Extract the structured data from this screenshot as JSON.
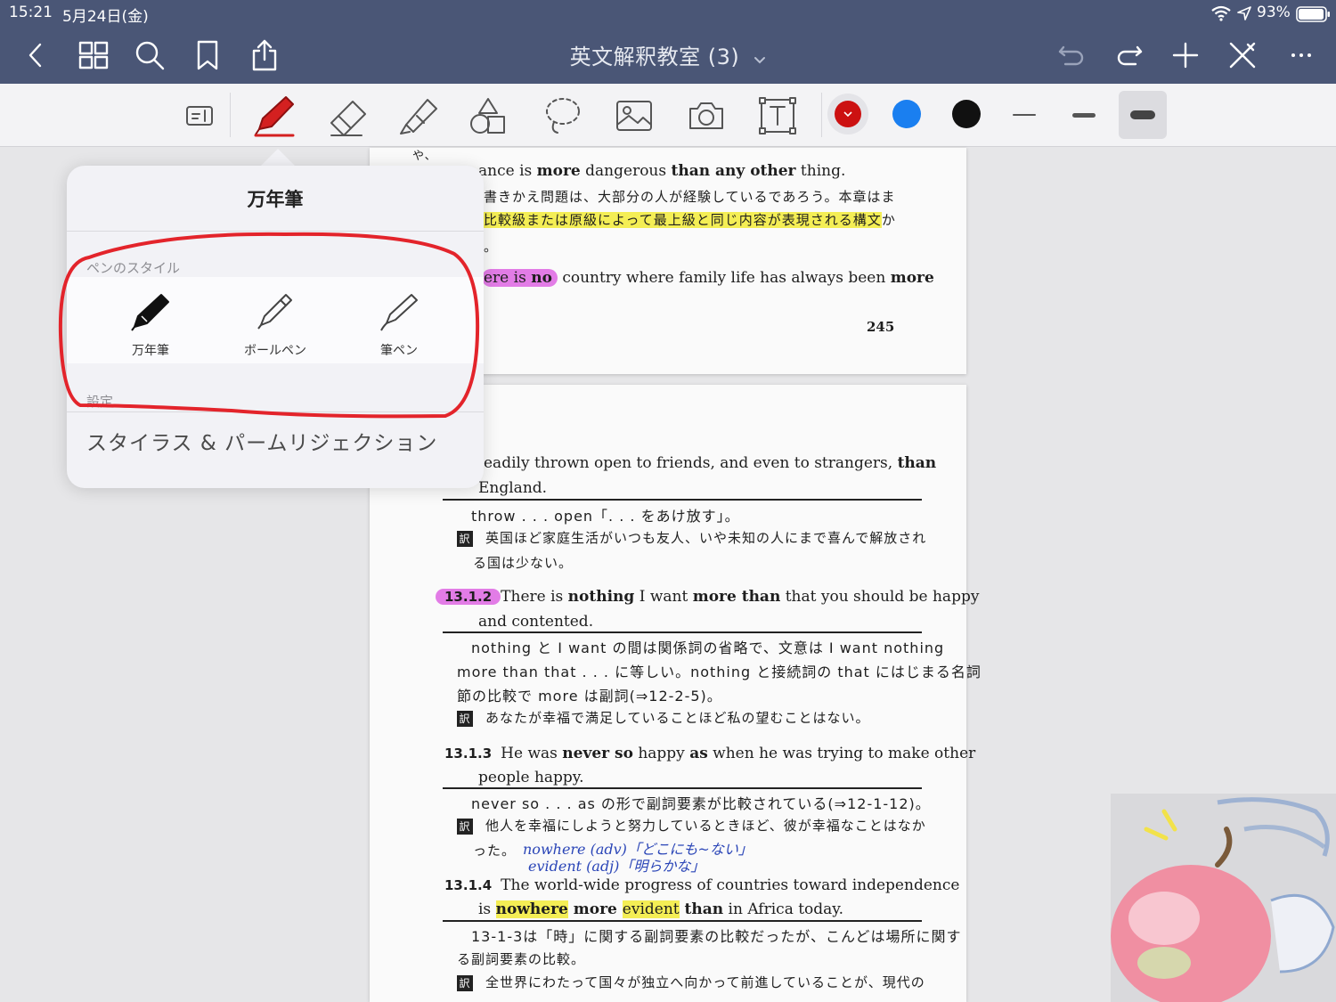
{
  "status_bar": {
    "time": "15:21",
    "date": "5月24日(金)",
    "battery_percent": "93%",
    "icons": [
      "wifi-icon",
      "location-icon",
      "battery-icon"
    ]
  },
  "nav": {
    "title": "英文解釈教室 (3)",
    "left_icons": [
      "back-icon",
      "grid-icon",
      "search-icon",
      "bookmark-icon",
      "share-icon"
    ],
    "right_icons": [
      "undo-icon",
      "redo-icon",
      "plus-icon",
      "close-icon",
      "more-icon"
    ]
  },
  "toolbar": {
    "tools": [
      "read-mode",
      "pen",
      "eraser",
      "highlighter",
      "shapes",
      "lasso",
      "image",
      "camera",
      "text"
    ],
    "selected_tool": "pen",
    "colors": [
      "#cc1111",
      "#1a7ff0",
      "#111111"
    ],
    "selected_color": "#cc1111",
    "thickness_selected": "thick"
  },
  "popover": {
    "title": "万年筆",
    "section_pen_style": "ペンのスタイル",
    "pens": [
      {
        "label": "万年筆"
      },
      {
        "label": "ボールペン"
      },
      {
        "label": "筆ペン"
      }
    ],
    "section_settings": "設定",
    "settings_item": "スタイラス & パームリジェクション"
  },
  "page1": {
    "top_fragment": "や、",
    "line1_pre": "ance is ",
    "line1_b1": "more",
    "line1_mid": " dangerous ",
    "line1_b2": "than any other",
    "line1_post": " thing.",
    "jp1": "書きかえ問題は、大部分の人が経験しているであろう。本章はま",
    "jp2_hl": "比較級または原級によって最上級と同じ内容が表現される構文",
    "jp2_tail": "か",
    "jp3": "。",
    "line4_hl_pre": "ere is ",
    "line4_hl_b": "no",
    "line4_post": " country where family life has always been ",
    "line4_b": "more",
    "page_number": "245"
  },
  "page2": {
    "l1_pre": "eadily thrown open to friends, and even to strangers, ",
    "l1_b": "than",
    "l2": "England.",
    "note1": "throw . . . open「. . . をあけ放す」。",
    "trans_mark": "訳",
    "trans1a": "英国ほど家庭生活がいつも友人、いや未知の人にまで喜んで解放され",
    "trans1b": "る国は少ない。",
    "ex2_num": "13.1.2",
    "ex2_pre": "There is ",
    "ex2_b1": "nothing",
    "ex2_mid": " I want ",
    "ex2_b2": "more than",
    "ex2_post": " that you should be happy",
    "ex2_l2": "and contented.",
    "note2a": "nothing と I  want の間は関係詞の省略で、文意は I  want  nothing",
    "note2b": "more than that . . . に等しい。nothing と接続詞の that にはじまる名詞",
    "note2c": "節の比較で more は副詞(⇒12-2-5)。",
    "trans2": "あなたが幸福で満足していることほど私の望むことはない。",
    "ex3_num": "13.1.3",
    "ex3_pre": "He was ",
    "ex3_b1": "never so",
    "ex3_mid": " happy ",
    "ex3_b2": "as",
    "ex3_post": " when he was trying to make other",
    "ex3_l2": "people happy.",
    "note3": "never so . . . as の形で副詞要素が比較されている(⇒12-1-12)。",
    "trans3a": "他人を幸福にしようと努力しているときほど、彼が幸福なことはなか",
    "trans3b": "った。",
    "hand1": "nowhere (adv)「どこにも~ない」",
    "hand2": "evident (adj)「明らかな」",
    "ex4_num": "13.1.4",
    "ex4_l1": "The world-wide progress of countries toward independence",
    "ex4_is": "is ",
    "ex4_hl1": "nowhere",
    "ex4_b": " more ",
    "ex4_hl2": "evident",
    "ex4_than": " than",
    "ex4_post": " in Africa today.",
    "note4a": "13-1-3は「時」に関する副詞要素の比較だったが、こんどは場所に関す",
    "note4b": "る副詞要素の比較。",
    "trans4": "全世界にわたって国々が独立へ向かって前進していることが、現代の"
  }
}
